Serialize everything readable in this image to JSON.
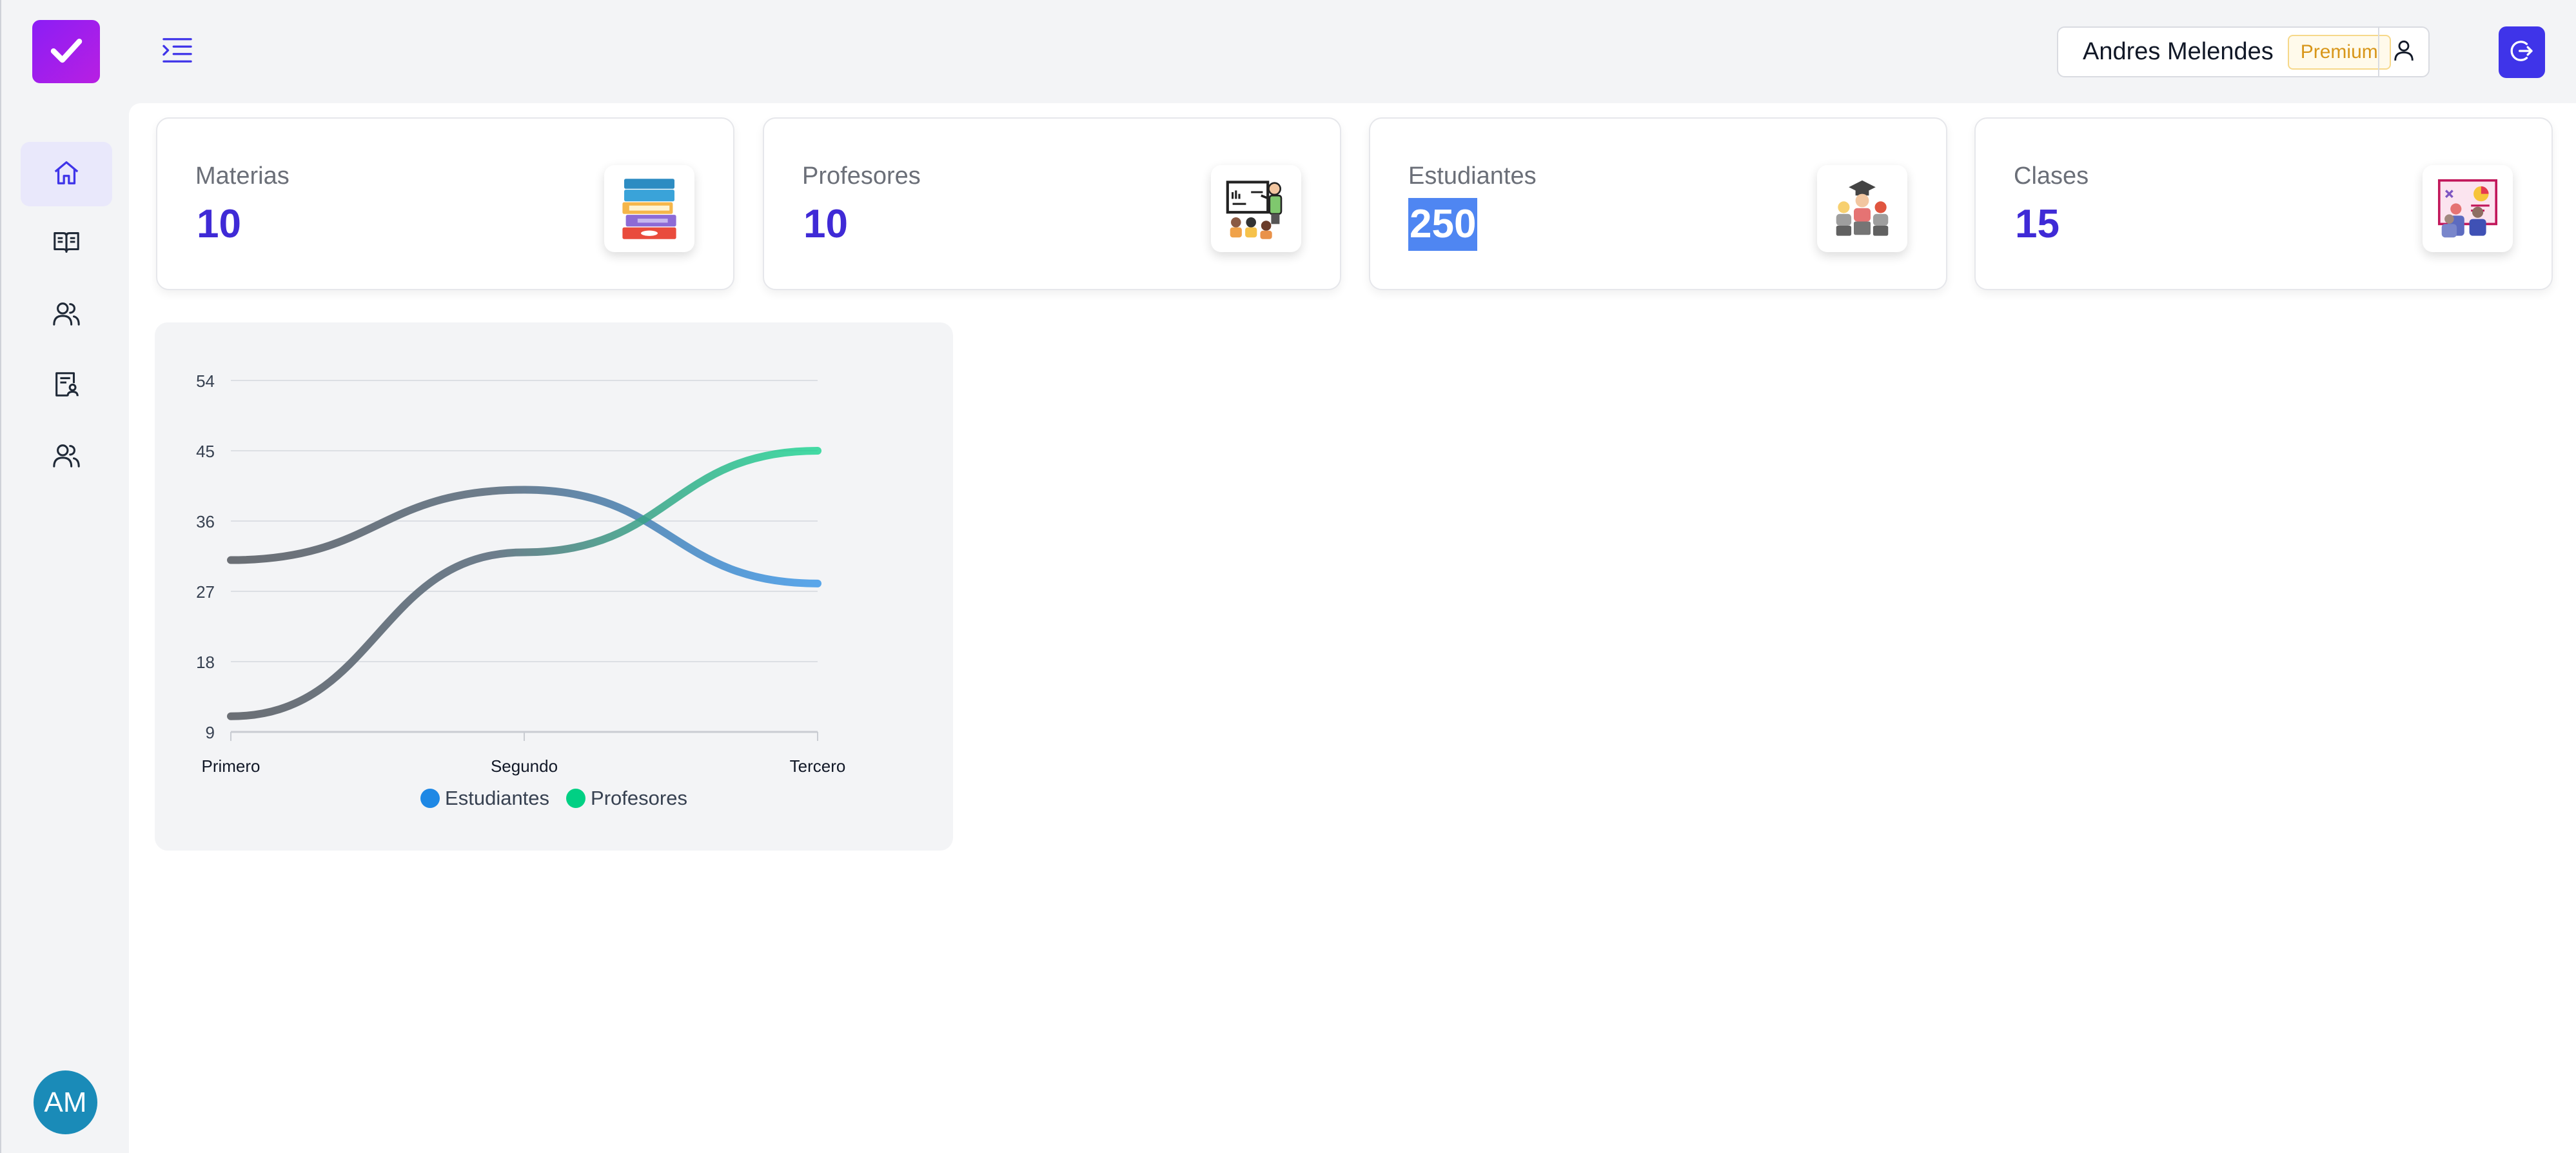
{
  "header": {
    "user_name": "Andres Melendes",
    "plan_badge": "Premium"
  },
  "sidebar": {
    "avatar_initials": "AM",
    "items": [
      {
        "name": "home",
        "icon": "home-icon",
        "active": true
      },
      {
        "name": "materias",
        "icon": "book-icon",
        "active": false
      },
      {
        "name": "profesores",
        "icon": "users-icon",
        "active": false
      },
      {
        "name": "estudiantes",
        "icon": "user-document-icon",
        "active": false
      },
      {
        "name": "clases",
        "icon": "users-icon",
        "active": false
      }
    ]
  },
  "stats": [
    {
      "label": "Materias",
      "value": "10",
      "icon": "books-stack-icon"
    },
    {
      "label": "Profesores",
      "value": "10",
      "icon": "teacher-board-icon"
    },
    {
      "label": "Estudiantes",
      "value": "250",
      "icon": "graduates-icon"
    },
    {
      "label": "Clases",
      "value": "15",
      "icon": "class-presentation-icon"
    }
  ],
  "colors": {
    "accent": "#3f2ad6",
    "logo_gradient_start": "#8b1ef5",
    "logo_gradient_end": "#b81fe2",
    "avatar": "#1a8bb8",
    "logout_button": "#3f34e9",
    "premium_text": "#d8961a"
  },
  "chart_data": {
    "type": "line",
    "categories": [
      "Primero",
      "Segundo",
      "Tercero"
    ],
    "series": [
      {
        "name": "Estudiantes",
        "values": [
          31,
          40,
          28
        ],
        "color": "#1e88e5"
      },
      {
        "name": "Profesores",
        "values": [
          11,
          32,
          45
        ],
        "color": "#00d084"
      }
    ],
    "yticks": [
      9,
      18,
      27,
      36,
      45,
      54
    ],
    "ylim": [
      9,
      54
    ],
    "grid": true,
    "smooth": true,
    "legend_position": "bottom"
  }
}
